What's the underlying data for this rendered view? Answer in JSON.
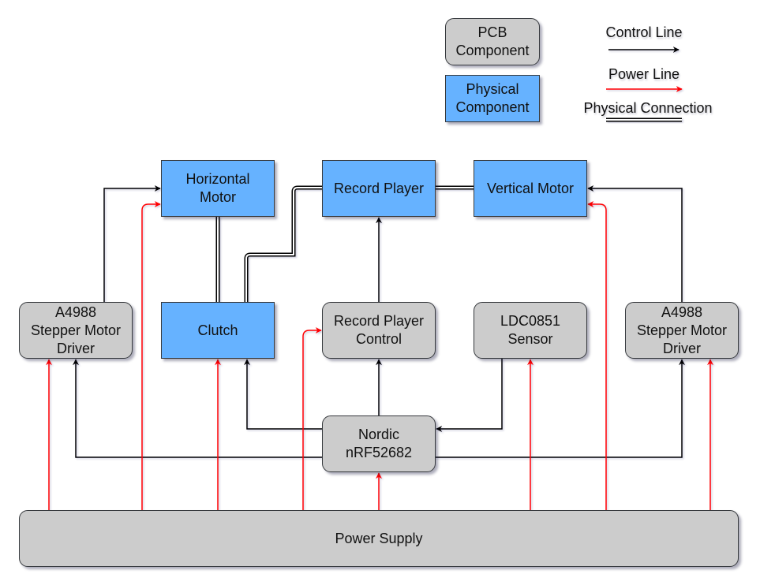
{
  "colors": {
    "pcb_fill": "#cccccc",
    "physical_fill": "#66b2ff",
    "control_line": "#000000",
    "power_line": "#ff0000"
  },
  "legend": {
    "pcb_box": [
      "PCB",
      "Component"
    ],
    "physical_box": [
      "Physical",
      "Component"
    ],
    "control_line": "Control Line",
    "power_line": "Power Line",
    "physical_connection": "Physical Connection"
  },
  "components": {
    "horizontal_motor": {
      "type": "physical",
      "lines": [
        "Horizontal",
        "Motor"
      ]
    },
    "record_player": {
      "type": "physical",
      "lines": [
        "Record Player"
      ]
    },
    "vertical_motor": {
      "type": "physical",
      "lines": [
        "Vertical Motor"
      ]
    },
    "driver_left": {
      "type": "pcb",
      "lines": [
        "A4988",
        "Stepper Motor",
        "Driver"
      ]
    },
    "clutch": {
      "type": "physical",
      "lines": [
        "Clutch"
      ]
    },
    "record_player_control": {
      "type": "pcb",
      "lines": [
        "Record Player",
        "Control"
      ]
    },
    "sensor": {
      "type": "pcb",
      "lines": [
        "LDC0851",
        "Sensor"
      ]
    },
    "driver_right": {
      "type": "pcb",
      "lines": [
        "A4988",
        "Stepper Motor",
        "Driver"
      ]
    },
    "nordic": {
      "type": "pcb",
      "lines": [
        "Nordic",
        "nRF52682"
      ]
    },
    "power_supply": {
      "type": "pcb",
      "lines": [
        "Power Supply"
      ]
    }
  },
  "connections": [
    {
      "from": "driver_left",
      "to": "horizontal_motor",
      "type": "control"
    },
    {
      "from": "driver_right",
      "to": "vertical_motor",
      "type": "control"
    },
    {
      "from": "record_player_control",
      "to": "record_player",
      "type": "control"
    },
    {
      "from": "nordic",
      "to": "record_player_control",
      "type": "control"
    },
    {
      "from": "nordic",
      "to": "clutch",
      "type": "control"
    },
    {
      "from": "sensor",
      "to": "nordic",
      "type": "control"
    },
    {
      "from": "nordic",
      "to": "driver_left",
      "type": "control"
    },
    {
      "from": "nordic",
      "to": "driver_right",
      "type": "control"
    },
    {
      "from": "power_supply",
      "to": "driver_left",
      "type": "power"
    },
    {
      "from": "power_supply",
      "to": "horizontal_motor",
      "type": "power"
    },
    {
      "from": "power_supply",
      "to": "clutch",
      "type": "power"
    },
    {
      "from": "power_supply",
      "to": "record_player_control",
      "type": "power"
    },
    {
      "from": "power_supply",
      "to": "nordic",
      "type": "power"
    },
    {
      "from": "power_supply",
      "to": "sensor",
      "type": "power"
    },
    {
      "from": "power_supply",
      "to": "vertical_motor",
      "type": "power"
    },
    {
      "from": "power_supply",
      "to": "driver_right",
      "type": "power"
    },
    {
      "from": "horizontal_motor",
      "to": "clutch",
      "type": "physical"
    },
    {
      "from": "clutch",
      "to": "record_player",
      "type": "physical"
    },
    {
      "from": "record_player",
      "to": "vertical_motor",
      "type": "physical"
    }
  ]
}
